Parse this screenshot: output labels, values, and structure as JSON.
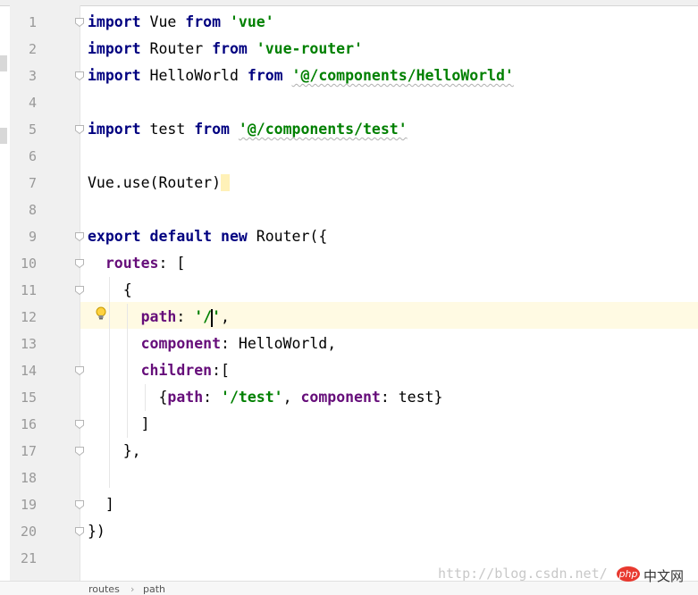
{
  "editor": {
    "lines": [
      {
        "n": "1",
        "tokens": [
          {
            "t": "import",
            "c": "kw"
          },
          {
            "t": " Vue ",
            "c": "plain"
          },
          {
            "t": "from",
            "c": "kw"
          },
          {
            "t": " ",
            "c": "plain"
          },
          {
            "t": "'vue'",
            "c": "str"
          }
        ]
      },
      {
        "n": "2",
        "tokens": [
          {
            "t": "import",
            "c": "kw"
          },
          {
            "t": " Router ",
            "c": "plain"
          },
          {
            "t": "from",
            "c": "kw"
          },
          {
            "t": " ",
            "c": "plain"
          },
          {
            "t": "'vue-router'",
            "c": "str"
          }
        ]
      },
      {
        "n": "3",
        "tokens": [
          {
            "t": "import",
            "c": "kw"
          },
          {
            "t": " HelloWorld ",
            "c": "plain"
          },
          {
            "t": "from",
            "c": "kw"
          },
          {
            "t": " ",
            "c": "plain"
          },
          {
            "t": "'@/components/HelloWorld'",
            "c": "str squiggle"
          }
        ]
      },
      {
        "n": "4",
        "tokens": []
      },
      {
        "n": "5",
        "tokens": [
          {
            "t": "import",
            "c": "kw"
          },
          {
            "t": " test ",
            "c": "plain"
          },
          {
            "t": "from",
            "c": "kw"
          },
          {
            "t": " ",
            "c": "plain"
          },
          {
            "t": "'@/components/test'",
            "c": "str squiggle"
          }
        ]
      },
      {
        "n": "6",
        "tokens": []
      },
      {
        "n": "7",
        "tokens": [
          {
            "t": "Vue.use(Router)",
            "c": "plain"
          },
          {
            "t": " ",
            "c": "plain hl-bracket"
          }
        ]
      },
      {
        "n": "8",
        "tokens": []
      },
      {
        "n": "9",
        "tokens": [
          {
            "t": "export",
            "c": "kw"
          },
          {
            "t": " ",
            "c": "plain"
          },
          {
            "t": "default",
            "c": "kw"
          },
          {
            "t": " ",
            "c": "plain"
          },
          {
            "t": "new",
            "c": "kw"
          },
          {
            "t": " Router({",
            "c": "plain"
          }
        ]
      },
      {
        "n": "10",
        "tokens": [
          {
            "t": "  ",
            "c": "plain"
          },
          {
            "t": "routes",
            "c": "prop"
          },
          {
            "t": ": [",
            "c": "plain"
          }
        ]
      },
      {
        "n": "11",
        "tokens": [
          {
            "t": "    {",
            "c": "plain"
          }
        ]
      },
      {
        "n": "12",
        "tokens": [
          {
            "t": "      ",
            "c": "plain"
          },
          {
            "t": "path",
            "c": "prop"
          },
          {
            "t": ": ",
            "c": "plain"
          },
          {
            "t": "'/",
            "c": "str"
          },
          {
            "t": "",
            "c": "caret"
          },
          {
            "t": "'",
            "c": "str"
          },
          {
            "t": ",",
            "c": "plain"
          }
        ]
      },
      {
        "n": "13",
        "tokens": [
          {
            "t": "      ",
            "c": "plain"
          },
          {
            "t": "component",
            "c": "prop"
          },
          {
            "t": ": HelloWorld,",
            "c": "plain"
          }
        ]
      },
      {
        "n": "14",
        "tokens": [
          {
            "t": "      ",
            "c": "plain"
          },
          {
            "t": "children",
            "c": "prop"
          },
          {
            "t": ":[",
            "c": "plain"
          }
        ]
      },
      {
        "n": "15",
        "tokens": [
          {
            "t": "        {",
            "c": "plain"
          },
          {
            "t": "path",
            "c": "prop"
          },
          {
            "t": ": ",
            "c": "plain"
          },
          {
            "t": "'/test'",
            "c": "str"
          },
          {
            "t": ", ",
            "c": "plain"
          },
          {
            "t": "component",
            "c": "prop"
          },
          {
            "t": ": test}",
            "c": "plain"
          }
        ]
      },
      {
        "n": "16",
        "tokens": [
          {
            "t": "      ]",
            "c": "plain"
          }
        ]
      },
      {
        "n": "17",
        "tokens": [
          {
            "t": "    },",
            "c": "plain"
          }
        ]
      },
      {
        "n": "18",
        "tokens": []
      },
      {
        "n": "19",
        "tokens": [
          {
            "t": "  ]",
            "c": "plain"
          }
        ]
      },
      {
        "n": "20",
        "tokens": [
          {
            "t": "})",
            "c": "plain"
          }
        ]
      },
      {
        "n": "21",
        "tokens": []
      }
    ],
    "current_line": 12,
    "fold_markers": [
      1,
      3,
      5,
      9,
      10,
      11,
      14,
      16,
      17,
      19,
      20
    ],
    "colors": {
      "keyword": "#000080",
      "string": "#008000",
      "property": "#660e7a",
      "caret_row": "#fffae3"
    }
  },
  "breadcrumb": {
    "items": [
      "routes",
      "path"
    ],
    "separator": "›"
  },
  "watermark": {
    "text": "http://blog.csdn.net/",
    "logo_text": "php",
    "site_text": "中文网"
  }
}
